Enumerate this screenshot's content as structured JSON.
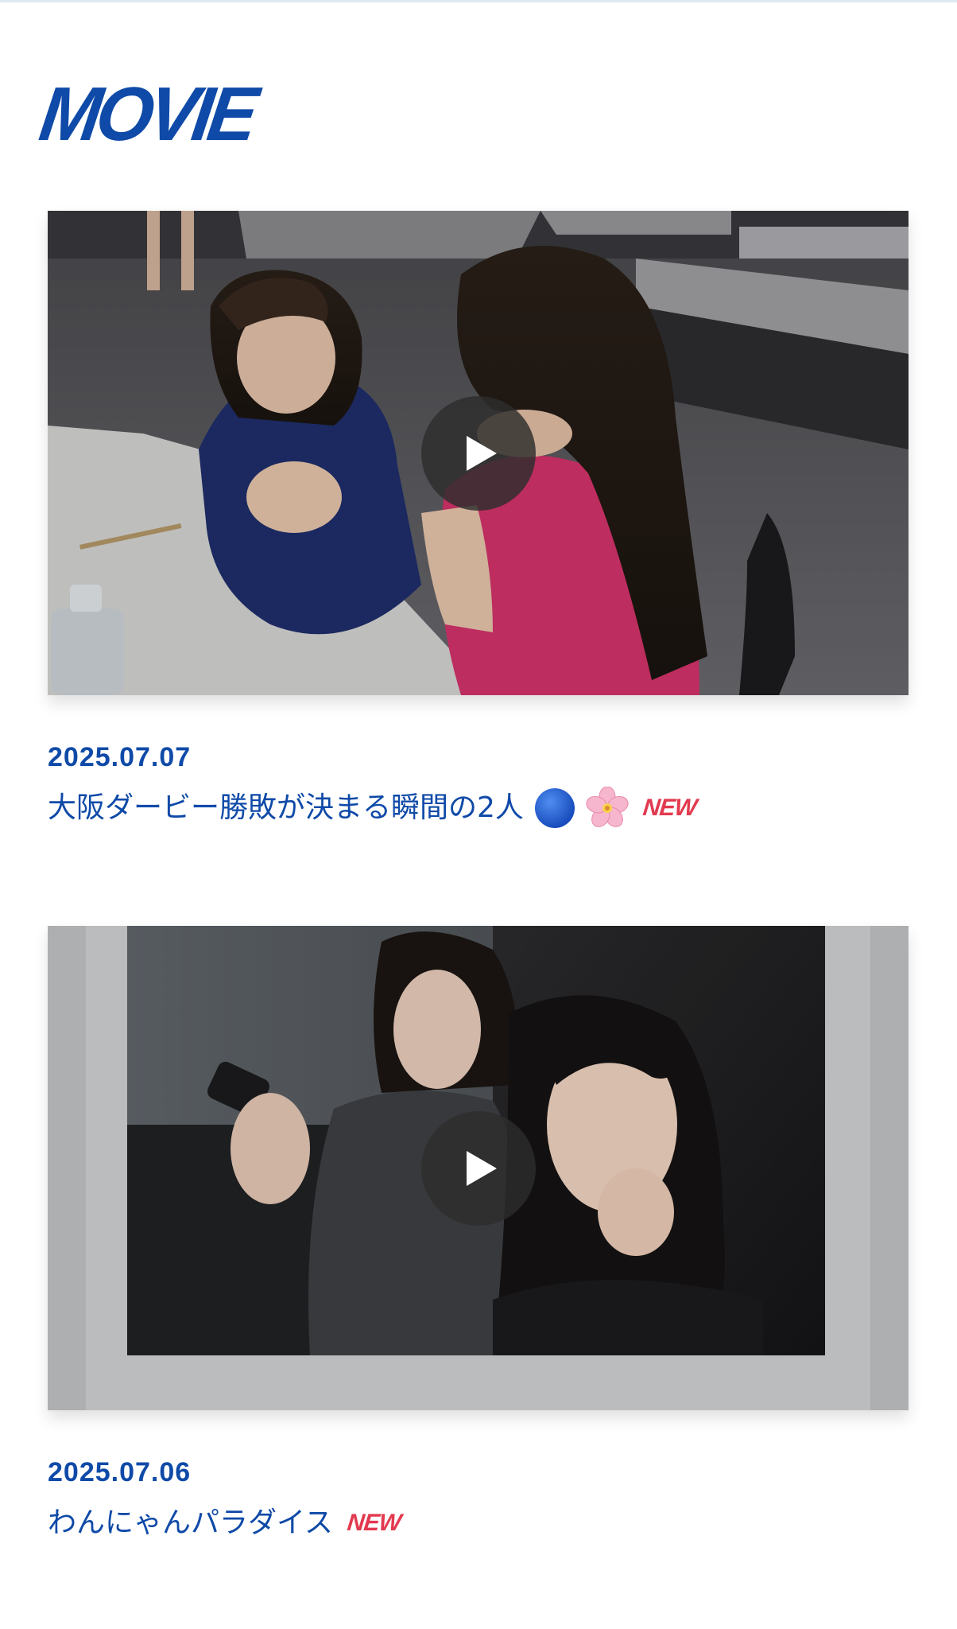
{
  "section": {
    "title": "MOVIE"
  },
  "colors": {
    "brand_blue": "#0f4aa8",
    "new_red": "#e23a4f"
  },
  "movies": [
    {
      "date": "2025.07.07",
      "title": "大阪ダービー勝敗が決まる瞬間の2人",
      "emojis": [
        "blue-circle-icon",
        "cherry-blossom-icon"
      ],
      "badge": "NEW",
      "thumbnail": "two-women-in-soccer-jerseys-at-table",
      "play_icon": "play-icon"
    },
    {
      "date": "2025.07.06",
      "title": "わんにゃんパラダイス",
      "emojis": [],
      "badge": "NEW",
      "thumbnail": "two-women-selfie-in-instant-photo-frame",
      "play_icon": "play-icon"
    }
  ]
}
